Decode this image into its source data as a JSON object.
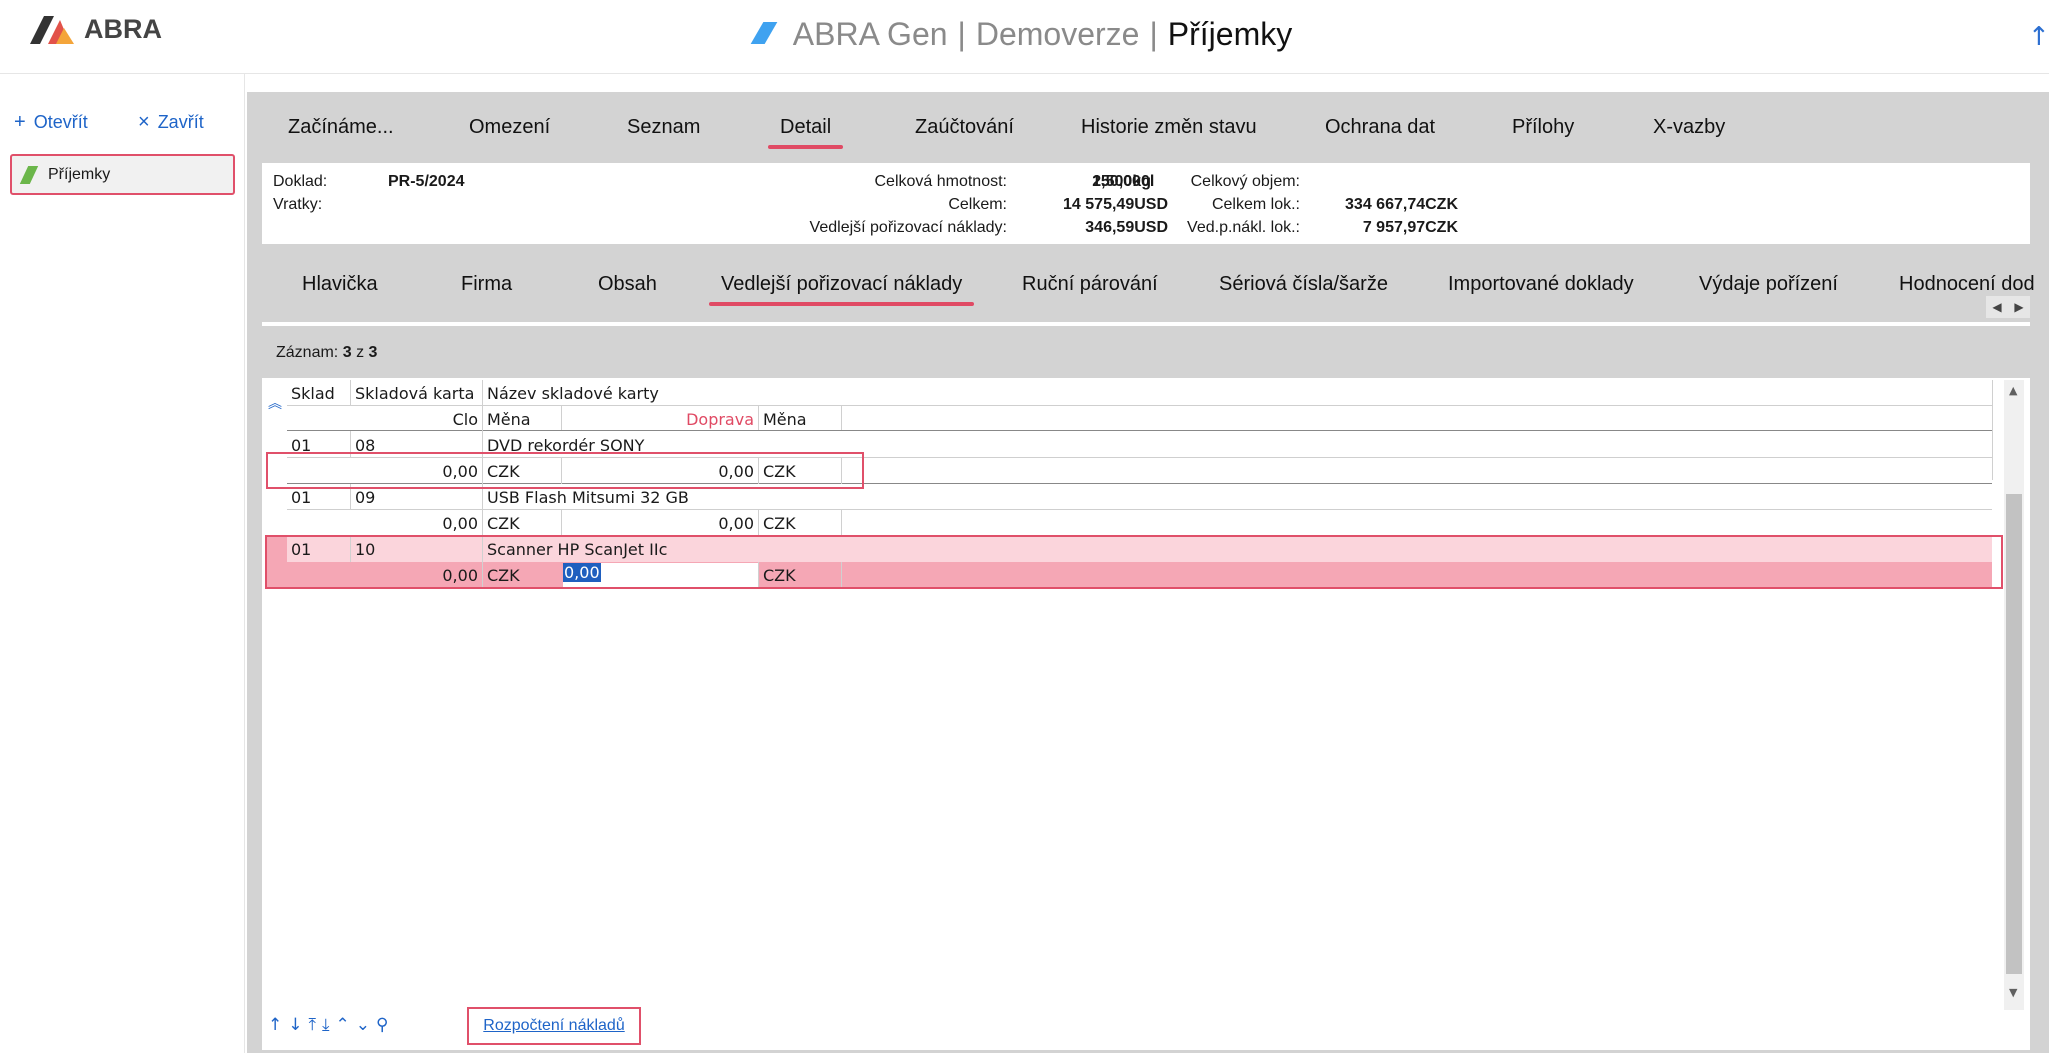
{
  "header": {
    "logo_text": "ABRA",
    "title_parts": [
      "ABRA Gen",
      "Demoverze",
      "Příjemky"
    ]
  },
  "sidebar": {
    "open_label": "Otevřít",
    "close_label": "Zavřít",
    "item_label": "Příjemky"
  },
  "main_tabs": [
    {
      "label": "Začínáme...",
      "active": false
    },
    {
      "label": "Omezení",
      "active": false
    },
    {
      "label": "Seznam",
      "active": false
    },
    {
      "label": "Detail",
      "active": true
    },
    {
      "label": "Zaúčtování",
      "active": false
    },
    {
      "label": "Historie změn stavu",
      "active": false
    },
    {
      "label": "Ochrana dat",
      "active": false
    },
    {
      "label": "Přílohy",
      "active": false
    },
    {
      "label": "X-vazby",
      "active": false
    }
  ],
  "info": {
    "doklad_label": "Doklad:",
    "doklad_value": "PR-5/2024",
    "vratky_label": "Vratky:",
    "hmotnost_label": "Celková hmotnost:",
    "hmotnost_value": "2,500kg",
    "objem_label": "Celkový objem:",
    "objem_value": "150,000l",
    "celkem_label": "Celkem:",
    "celkem_value": "14 575,49USD",
    "celkem_lok_label": "Celkem lok.:",
    "celkem_lok_value": "334 667,74CZK",
    "vpn_label": "Vedlejší pořizovací náklady:",
    "vpn_value": "346,59USD",
    "vpn_lok_label": "Ved.p.nákl. lok.:",
    "vpn_lok_value": "7 957,97CZK"
  },
  "sub_tabs": [
    {
      "label": "Hlavička",
      "active": false
    },
    {
      "label": "Firma",
      "active": false
    },
    {
      "label": "Obsah",
      "active": false
    },
    {
      "label": "Vedlejší pořizovací náklady",
      "active": true
    },
    {
      "label": "Ruční párování",
      "active": false
    },
    {
      "label": "Sériová čísla/šarže",
      "active": false
    },
    {
      "label": "Importované doklady",
      "active": false
    },
    {
      "label": "Výdaje pořízení",
      "active": false
    },
    {
      "label": "Hodnocení dod",
      "active": false
    }
  ],
  "record": {
    "label": "Záznam:",
    "current": "3",
    "of": "z",
    "total": "3"
  },
  "grid": {
    "headers": {
      "sklad": "Sklad",
      "karta": "Skladová karta",
      "nazev": "Název skladové karty",
      "clo": "Clo",
      "mena1": "Měna",
      "doprava": "Doprava",
      "mena2": "Měna"
    },
    "rows": [
      {
        "sklad": "01",
        "karta": "08",
        "nazev": "DVD rekordér SONY",
        "clo": "0,00",
        "mena1": "CZK",
        "doprava": "0,00",
        "mena2": "CZK"
      },
      {
        "sklad": "01",
        "karta": "09",
        "nazev": "USB Flash Mitsumi 32 GB",
        "clo": "0,00",
        "mena1": "CZK",
        "doprava": "0,00",
        "mena2": "CZK"
      },
      {
        "sklad": "01",
        "karta": "10",
        "nazev": "Scanner HP ScanJet IIc",
        "clo": "0,00",
        "mena1": "CZK",
        "doprava": "0,00",
        "mena2": "CZK"
      }
    ]
  },
  "footer": {
    "budget_label": "Rozpočtení nákladů"
  },
  "colors": {
    "accent": "#e04a64",
    "link": "#1e64c8",
    "selection": "#f5a7b5"
  }
}
